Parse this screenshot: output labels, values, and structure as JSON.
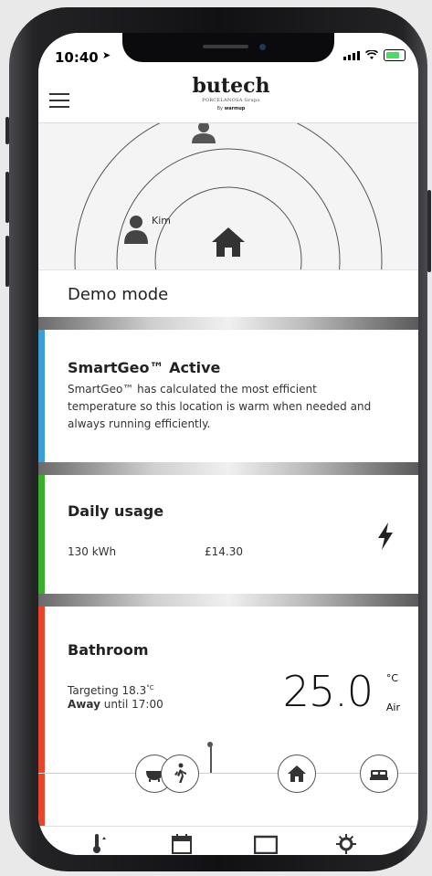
{
  "status": {
    "time": "10:40"
  },
  "header": {
    "brand": "butech",
    "brand_sub": "PORCELANOSA Grupo",
    "brand_by": "By",
    "brand_partner": "warmup"
  },
  "map": {
    "person_label": "Kim"
  },
  "demo_mode": {
    "label": "Demo mode"
  },
  "smartgeo": {
    "title": "SmartGeo™ Active",
    "text": "SmartGeo™ has calculated the most efficient temperature so this location is warm when needed and always running efficiently."
  },
  "daily_usage": {
    "title": "Daily usage",
    "kwh": "130 kWh",
    "cost": "£14.30"
  },
  "bathroom": {
    "title": "Bathroom",
    "targeting_text": "Targeting 18.3",
    "targeting_unit": "°C",
    "away_bold": "Away",
    "away_rest": " until 17:00",
    "temperature": "25.0",
    "unit": "°C",
    "sensor": "Air"
  },
  "colors": {
    "smartgeo_stripe": "#3a9fd6",
    "usage_stripe": "#3aae2a",
    "bathroom_stripe": "#e8452c"
  },
  "icons": [
    "menu-icon",
    "person-icon",
    "home-icon",
    "bolt-icon",
    "bath-icon",
    "walking-icon",
    "bed-icon",
    "gear-icon"
  ]
}
